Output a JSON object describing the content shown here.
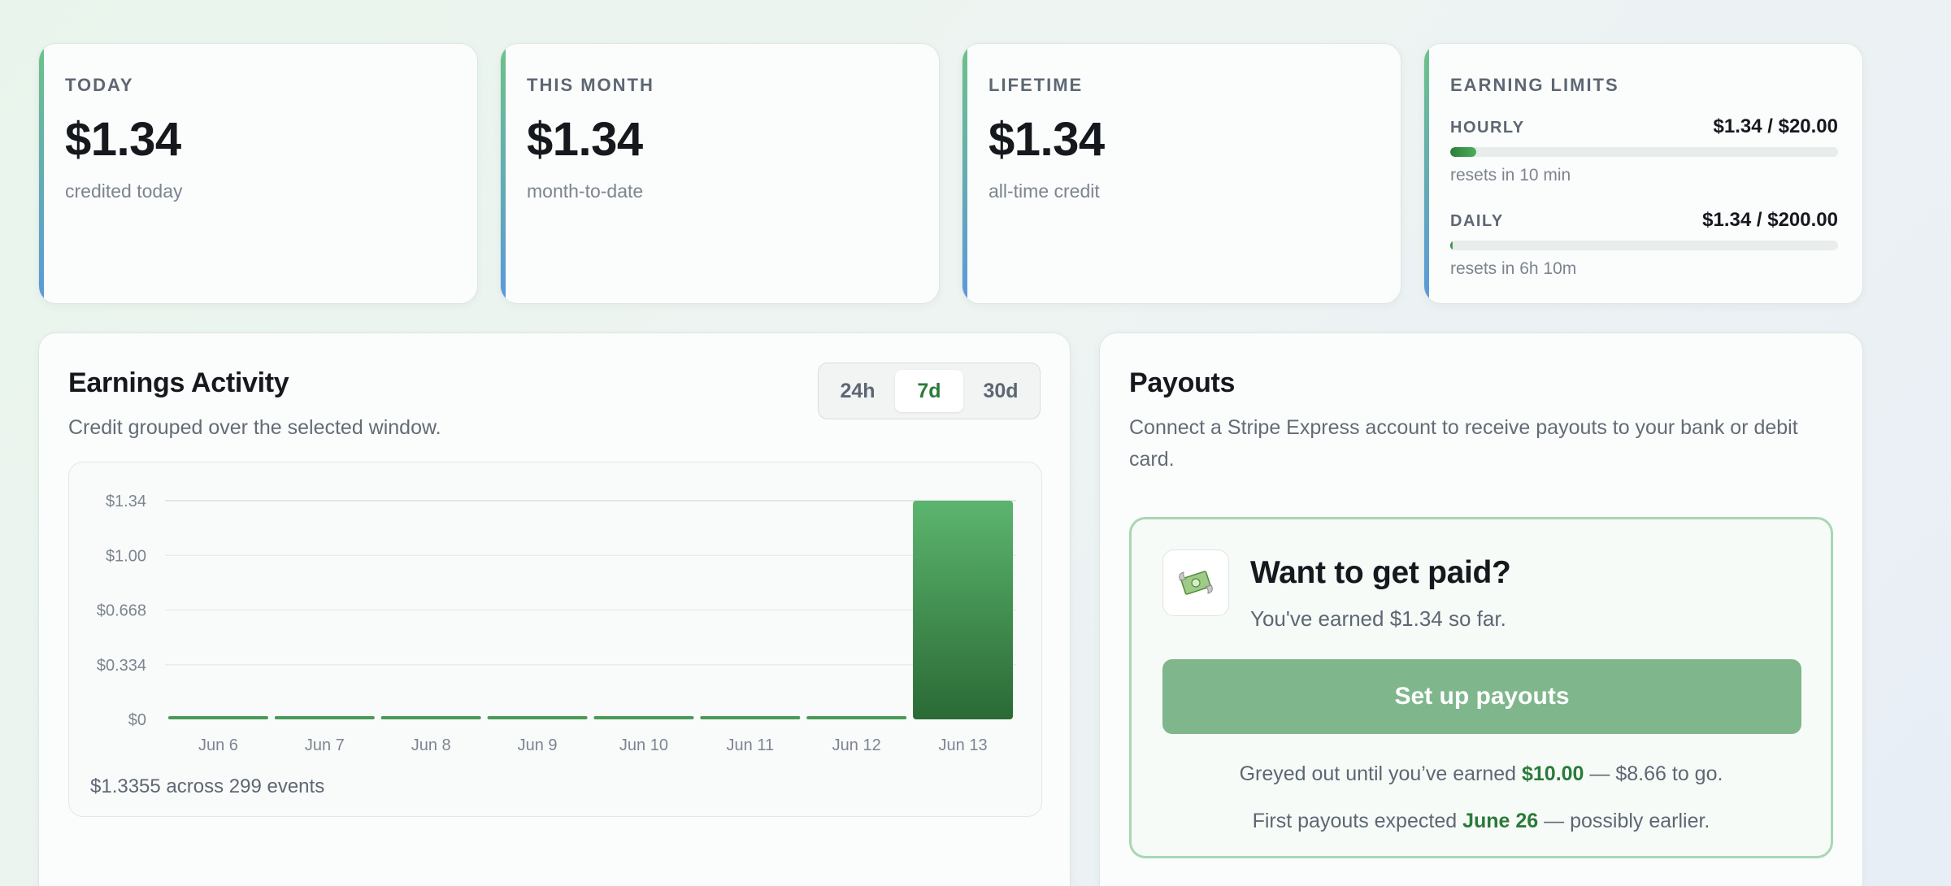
{
  "stats": [
    {
      "label": "TODAY",
      "value": "$1.34",
      "sub": "credited today"
    },
    {
      "label": "THIS MONTH",
      "value": "$1.34",
      "sub": "month-to-date"
    },
    {
      "label": "LIFETIME",
      "value": "$1.34",
      "sub": "all-time credit"
    }
  ],
  "limits": {
    "title": "EARNING LIMITS",
    "hourly": {
      "label": "HOURLY",
      "value": "$1.34 / $20.00",
      "reset": "resets in 10 min",
      "fraction": 0.067
    },
    "daily": {
      "label": "DAILY",
      "value": "$1.34 / $200.00",
      "reset": "resets in 6h 10m",
      "fraction": 0.0067
    }
  },
  "activity": {
    "title": "Earnings Activity",
    "description": "Credit grouped over the selected window.",
    "ranges": [
      "24h",
      "7d",
      "30d"
    ],
    "active_range": "7d",
    "footer": "$1.3355 across 299 events"
  },
  "chart_data": {
    "type": "bar",
    "categories": [
      "Jun 6",
      "Jun 7",
      "Jun 8",
      "Jun 9",
      "Jun 10",
      "Jun 11",
      "Jun 12",
      "Jun 13"
    ],
    "values": [
      0,
      0,
      0,
      0,
      0,
      0,
      0,
      1.3355
    ],
    "yticks": [
      "$0",
      "$0.334",
      "$0.668",
      "$1.00",
      "$1.34"
    ],
    "ylim": [
      0,
      1.3355
    ],
    "grid": true,
    "bar_color_top": "#5cb56e",
    "bar_color_bottom": "#2a6a35"
  },
  "payouts": {
    "title": "Payouts",
    "description": "Connect a Stripe Express account to receive payouts to your bank or debit card.",
    "promo_icon": "money-with-wings-icon",
    "promo_title": "Want to get paid?",
    "promo_sub": "You've earned $1.34 so far.",
    "button": "Set up payouts",
    "greyed_prefix": "Greyed out until you’ve earned ",
    "greyed_amount": "$10.00",
    "greyed_suffix": " — $8.66 to go.",
    "expected_prefix": "First payouts expected ",
    "expected_date": "June 26",
    "expected_suffix": " — possibly earlier."
  },
  "colors": {
    "accent": "#2b7a38",
    "button": "#7fb68c",
    "border_green": "#a8d7b3"
  }
}
